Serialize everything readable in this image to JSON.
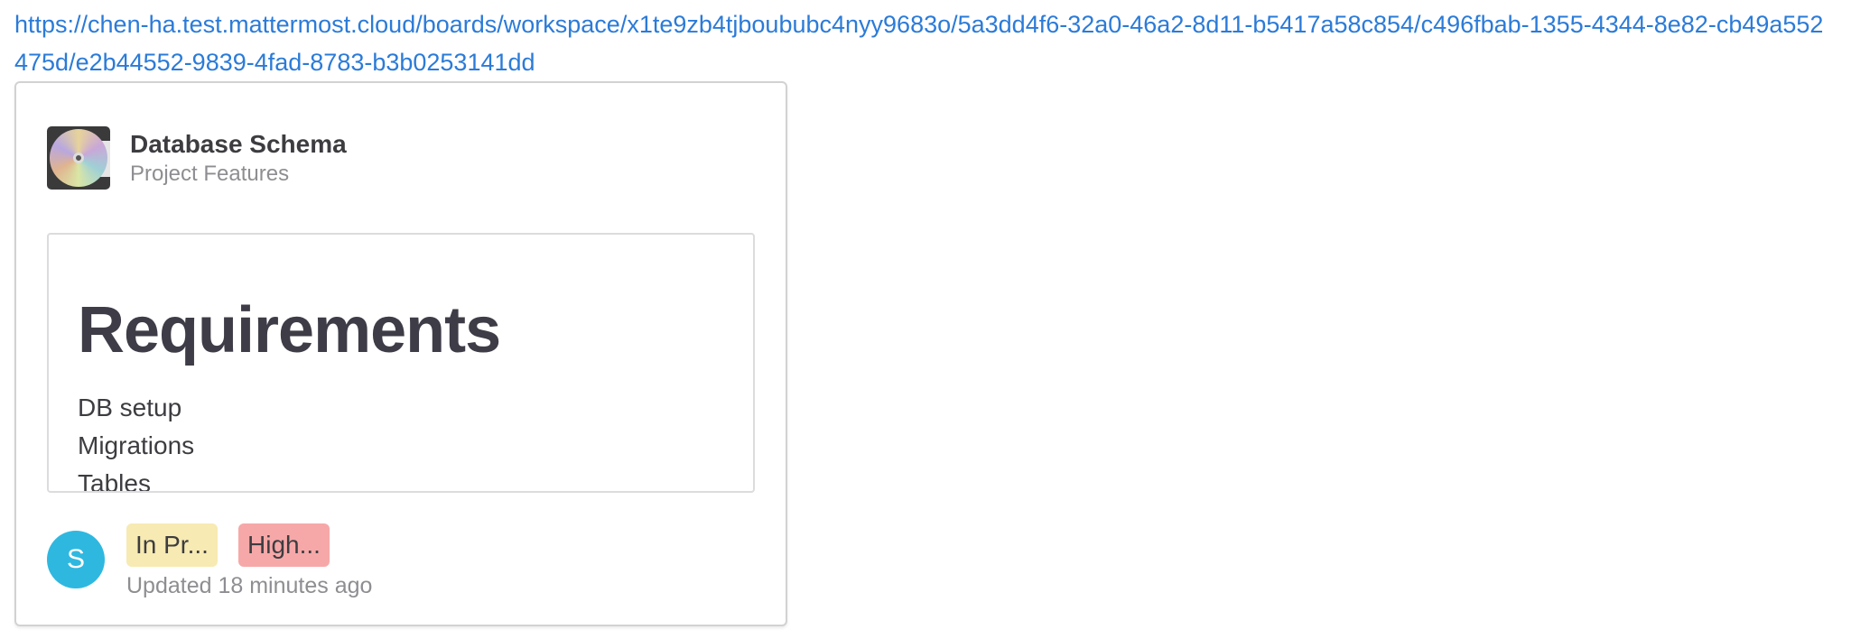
{
  "link": {
    "url": "https://chen-ha.test.mattermost.cloud/boards/workspace/x1te9zb4tjboububc4nyy9683o/5a3dd4f6-32a0-46a2-8d11-b5417a58c854/c496fbab-1355-4344-8e82-cb49a552475d/e2b44552-9839-4fad-8783-b3b0253141dd"
  },
  "card": {
    "icon": "compact-disc-icon",
    "title": "Database Schema",
    "subtitle": "Project Features",
    "preview": {
      "heading": "Requirements",
      "lines": [
        "DB setup",
        "Migrations",
        "Tables"
      ]
    },
    "avatar_initial": "S",
    "badges": {
      "status": "In Pr...",
      "priority": "High..."
    },
    "updated": "Updated 18 minutes ago"
  },
  "colors": {
    "link": "#2b7bd8",
    "avatar": "#2eb8e0",
    "status_badge": "#f7eab2",
    "priority_badge": "#f6a8a8"
  }
}
